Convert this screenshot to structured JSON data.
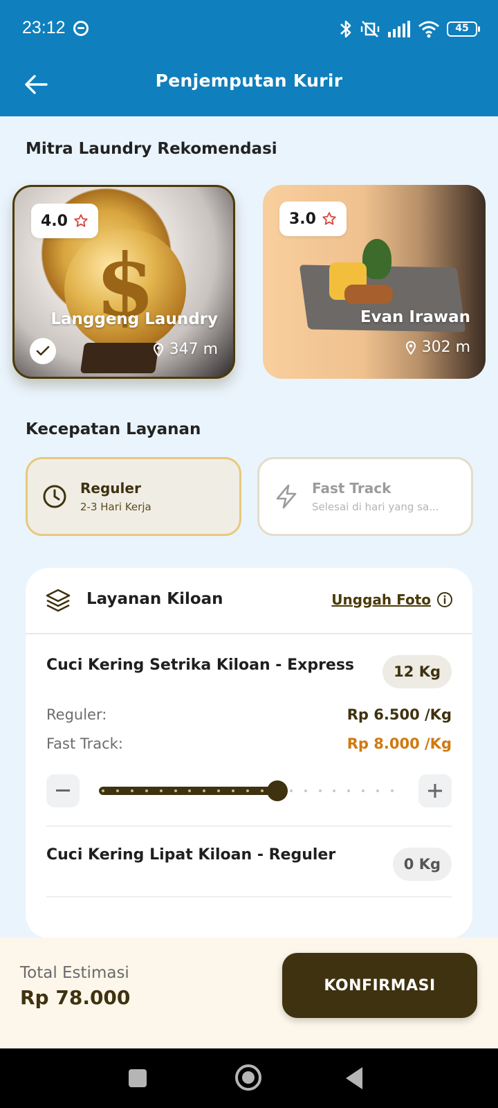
{
  "status_bar": {
    "time": "23:12",
    "battery": "45"
  },
  "header": {
    "title": "Penjemputan Kurir"
  },
  "recommend": {
    "title": "Mitra Laundry Rekomendasi",
    "partners": [
      {
        "name": "Langgeng Laundry",
        "rating": "4.0",
        "distance": "347 m",
        "selected": true
      },
      {
        "name": "Evan Irawan",
        "rating": "3.0",
        "distance": "302 m",
        "selected": false
      }
    ]
  },
  "speed": {
    "title": "Kecepatan Layanan",
    "options": [
      {
        "title": "Reguler",
        "subtitle": "2-3 Hari Kerja",
        "selected": true
      },
      {
        "title": "Fast Track",
        "subtitle": "Selesai di hari yang sa...",
        "selected": false
      }
    ]
  },
  "service": {
    "title": "Layanan Kiloan",
    "upload_label": "Unggah Foto",
    "items": [
      {
        "name": "Cuci Kering Setrika Kiloan - Express",
        "qty": "12 Kg",
        "reguler_label": "Reguler:",
        "reguler_price": "Rp 6.500 /Kg",
        "fast_label": "Fast Track:",
        "fast_price": "Rp 8.000 /Kg",
        "slider_fraction": 0.6
      },
      {
        "name": "Cuci Kering Lipat Kiloan - Reguler",
        "qty": "0 Kg"
      }
    ]
  },
  "footer": {
    "total_label": "Total Estimasi",
    "total_value": "Rp 78.000",
    "confirm_label": "KONFIRMASI"
  },
  "colors": {
    "primary": "#0f7fbd",
    "accent_dark": "#3f3210",
    "fast_price": "#d07a10",
    "selected_bg": "#f0ede5"
  }
}
